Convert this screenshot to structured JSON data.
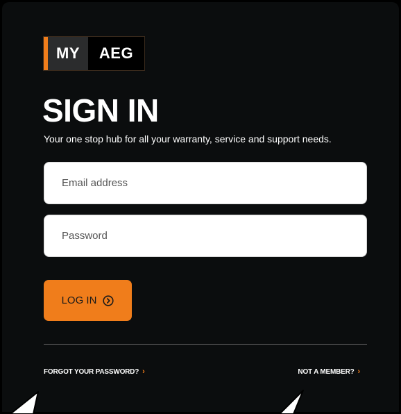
{
  "logo": {
    "my": "MY",
    "brand": "AEG"
  },
  "page": {
    "title": "SIGN IN",
    "subtitle": "Your one stop hub for all your warranty, service and support needs."
  },
  "form": {
    "email_placeholder": "Email address",
    "email_value": "",
    "password_placeholder": "Password",
    "password_value": "",
    "login_label": "LOG IN"
  },
  "links": {
    "forgot": "FORGOT YOUR PASSWORD?",
    "member": "NOT A MEMBER?"
  },
  "icons": {
    "login": "chevron-right-circle-icon",
    "link_arrow": "chevron-right-icon"
  },
  "colors": {
    "background": "#0b0d0e",
    "accent": "#f07d1b",
    "text": "#ffffff",
    "field": "#ffffff"
  }
}
